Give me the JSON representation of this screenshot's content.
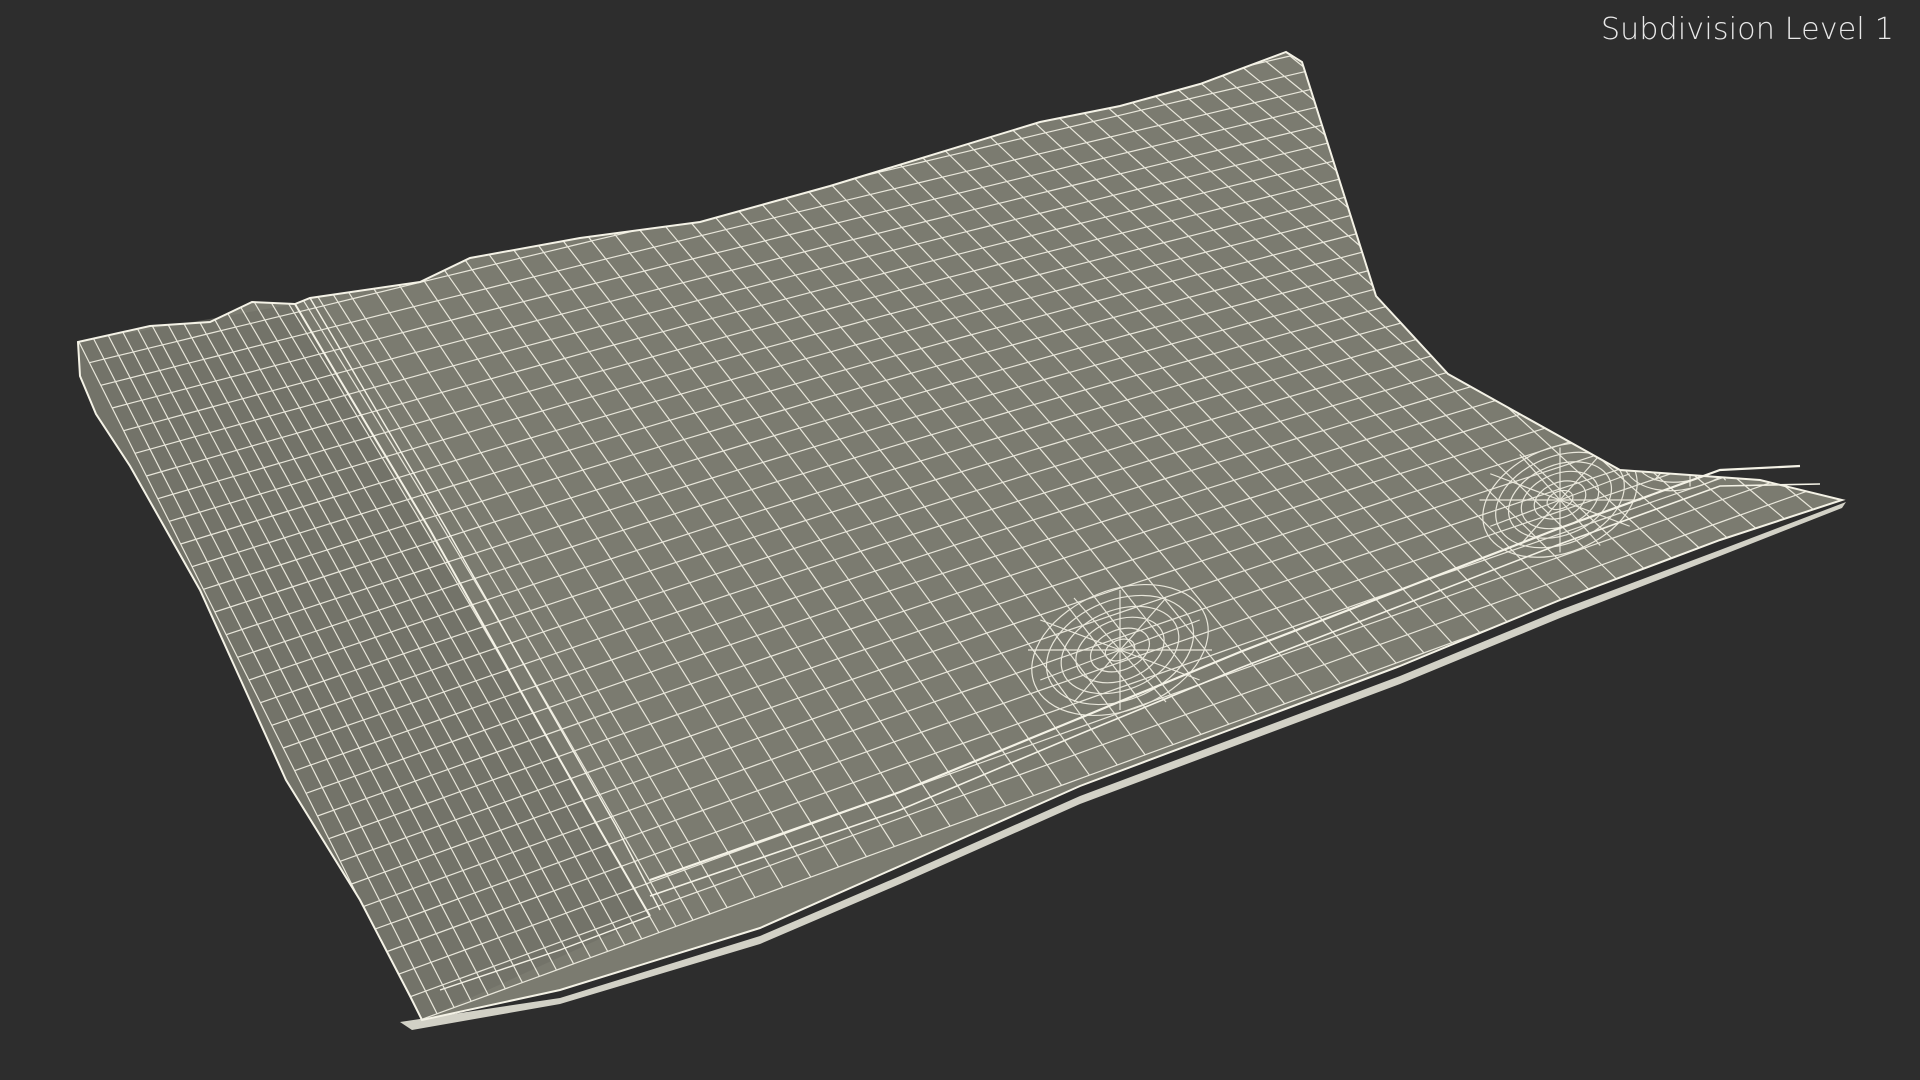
{
  "viewport": {
    "background_color": "#2d2d2d",
    "subdivision_label": "Subdivision Level 1"
  },
  "model": {
    "surface_color": "#7b7b70",
    "wire_color": "#f2f0e4",
    "shadow_color": "#5d5d54"
  }
}
